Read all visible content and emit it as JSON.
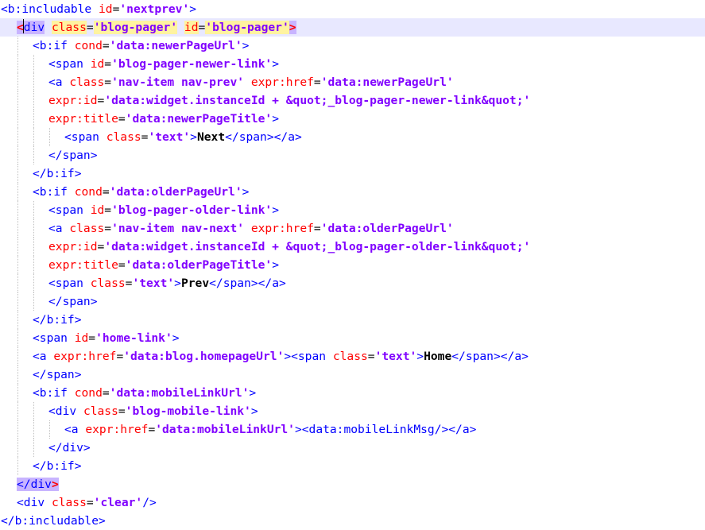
{
  "editor": {
    "language": "xml",
    "current_line": 2,
    "caret_line": 2,
    "colors": {
      "tag": "#0000ff",
      "attribute": "#ff0000",
      "value": "#8000ff",
      "text": "#000000",
      "current_line_bg": "#e8e8ff",
      "brace_match_bg": "#c8b4ff",
      "smart_highlight_bg": "#fff3a0"
    },
    "lines": [
      [
        [
          "tag",
          "<b:includable "
        ],
        [
          "attr",
          "id"
        ],
        [
          "eq",
          "="
        ],
        [
          "val",
          "'nextprev'"
        ],
        [
          "tag",
          ">"
        ]
      ],
      [
        [
          "bmred",
          "<"
        ],
        [
          "bmtag",
          "div"
        ],
        [
          "tag",
          " "
        ],
        [
          "hlattr",
          "class"
        ],
        [
          "eq",
          "="
        ],
        [
          "hlval",
          "'blog-pager'"
        ],
        [
          "tag",
          " "
        ],
        [
          "hlattr",
          "id"
        ],
        [
          "eq",
          "="
        ],
        [
          "hlval",
          "'blog-pager'"
        ],
        [
          "bmred",
          ">"
        ]
      ],
      [
        [
          "tag",
          "<b:if "
        ],
        [
          "attr",
          "cond"
        ],
        [
          "eq",
          "="
        ],
        [
          "val",
          "'data:newerPageUrl'"
        ],
        [
          "tag",
          ">"
        ]
      ],
      [
        [
          "tag",
          "<span "
        ],
        [
          "attr",
          "id"
        ],
        [
          "eq",
          "="
        ],
        [
          "val",
          "'blog-pager-newer-link'"
        ],
        [
          "tag",
          ">"
        ]
      ],
      [
        [
          "tag",
          "<a "
        ],
        [
          "attr",
          "class"
        ],
        [
          "eq",
          "="
        ],
        [
          "val",
          "'nav-item nav-prev'"
        ],
        [
          "tag",
          " "
        ],
        [
          "attr",
          "expr:href"
        ],
        [
          "eq",
          "="
        ],
        [
          "val",
          "'data:newerPageUrl'"
        ]
      ],
      [
        [
          "attr",
          "expr:id"
        ],
        [
          "eq",
          "="
        ],
        [
          "val",
          "'data:widget.instanceId + &quot;_blog-pager-newer-link&quot;'"
        ]
      ],
      [
        [
          "attr",
          "expr:title"
        ],
        [
          "eq",
          "="
        ],
        [
          "val",
          "'data:newerPageTitle'"
        ],
        [
          "tag",
          ">"
        ]
      ],
      [
        [
          "tag",
          "<span "
        ],
        [
          "attr",
          "class"
        ],
        [
          "eq",
          "="
        ],
        [
          "val",
          "'text'"
        ],
        [
          "tag",
          ">"
        ],
        [
          "txt",
          "Next"
        ],
        [
          "tag",
          "</span></a>"
        ]
      ],
      [
        [
          "tag",
          "</span>"
        ]
      ],
      [
        [
          "tag",
          "</b:if>"
        ]
      ],
      [
        [
          "tag",
          "<b:if "
        ],
        [
          "attr",
          "cond"
        ],
        [
          "eq",
          "="
        ],
        [
          "val",
          "'data:olderPageUrl'"
        ],
        [
          "tag",
          ">"
        ]
      ],
      [
        [
          "tag",
          "<span "
        ],
        [
          "attr",
          "id"
        ],
        [
          "eq",
          "="
        ],
        [
          "val",
          "'blog-pager-older-link'"
        ],
        [
          "tag",
          ">"
        ]
      ],
      [
        [
          "tag",
          "<a "
        ],
        [
          "attr",
          "class"
        ],
        [
          "eq",
          "="
        ],
        [
          "val",
          "'nav-item nav-next'"
        ],
        [
          "tag",
          " "
        ],
        [
          "attr",
          "expr:href"
        ],
        [
          "eq",
          "="
        ],
        [
          "val",
          "'data:olderPageUrl'"
        ]
      ],
      [
        [
          "attr",
          "expr:id"
        ],
        [
          "eq",
          "="
        ],
        [
          "val",
          "'data:widget.instanceId + &quot;_blog-pager-older-link&quot;'"
        ]
      ],
      [
        [
          "attr",
          "expr:title"
        ],
        [
          "eq",
          "="
        ],
        [
          "val",
          "'data:olderPageTitle'"
        ],
        [
          "tag",
          ">"
        ]
      ],
      [
        [
          "tag",
          "<span "
        ],
        [
          "attr",
          "class"
        ],
        [
          "eq",
          "="
        ],
        [
          "val",
          "'text'"
        ],
        [
          "tag",
          ">"
        ],
        [
          "txt",
          "Prev"
        ],
        [
          "tag",
          "</span></a>"
        ]
      ],
      [
        [
          "tag",
          "</span>"
        ]
      ],
      [
        [
          "tag",
          "</b:if>"
        ]
      ],
      [
        [
          "tag",
          "<span "
        ],
        [
          "attr",
          "id"
        ],
        [
          "eq",
          "="
        ],
        [
          "val",
          "'home-link'"
        ],
        [
          "tag",
          ">"
        ]
      ],
      [
        [
          "tag",
          "<a "
        ],
        [
          "attr",
          "expr:href"
        ],
        [
          "eq",
          "="
        ],
        [
          "val",
          "'data:blog.homepageUrl'"
        ],
        [
          "tag",
          "><span "
        ],
        [
          "attr",
          "class"
        ],
        [
          "eq",
          "="
        ],
        [
          "val",
          "'text'"
        ],
        [
          "tag",
          ">"
        ],
        [
          "txt",
          "Home"
        ],
        [
          "tag",
          "</span></a>"
        ]
      ],
      [
        [
          "tag",
          "</span>"
        ]
      ],
      [
        [
          "tag",
          "<b:if "
        ],
        [
          "attr",
          "cond"
        ],
        [
          "eq",
          "="
        ],
        [
          "val",
          "'data:mobileLinkUrl'"
        ],
        [
          "tag",
          ">"
        ]
      ],
      [
        [
          "tag",
          "<div "
        ],
        [
          "attr",
          "class"
        ],
        [
          "eq",
          "="
        ],
        [
          "val",
          "'blog-mobile-link'"
        ],
        [
          "tag",
          ">"
        ]
      ],
      [
        [
          "tag",
          "<a "
        ],
        [
          "attr",
          "expr:href"
        ],
        [
          "eq",
          "="
        ],
        [
          "val",
          "'data:mobileLinkUrl'"
        ],
        [
          "tag",
          "><data:mobileLinkMsg/></a>"
        ]
      ],
      [
        [
          "tag",
          "</div>"
        ]
      ],
      [
        [
          "tag",
          "</b:if>"
        ]
      ],
      [
        [
          "bmtag",
          "</div"
        ],
        [
          "bmred",
          ">"
        ]
      ],
      [
        [
          "tag",
          "<div "
        ],
        [
          "attr",
          "class"
        ],
        [
          "eq",
          "="
        ],
        [
          "val",
          "'clear'"
        ],
        [
          "tag",
          "/>"
        ]
      ],
      [
        [
          "tag",
          "</b:includable>"
        ]
      ]
    ]
  }
}
